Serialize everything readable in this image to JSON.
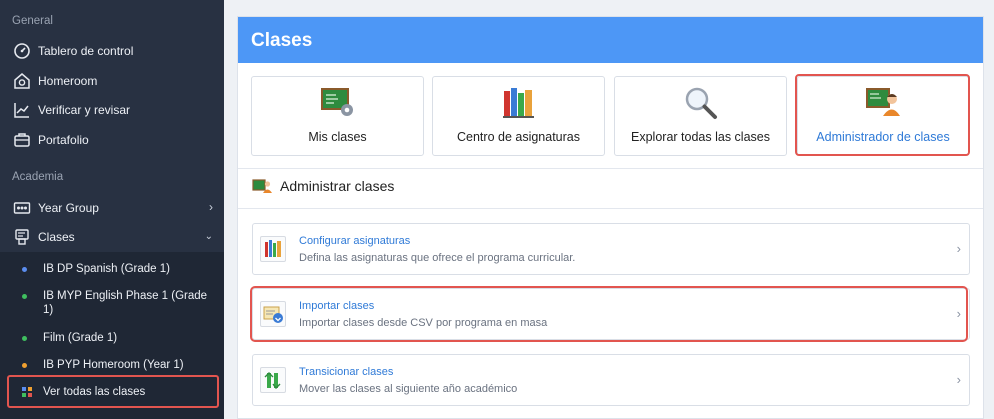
{
  "sidebar": {
    "section_general": "General",
    "section_academia": "Academia",
    "items": [
      {
        "label": "Tablero de control",
        "icon": "dashboard-icon"
      },
      {
        "label": "Homeroom",
        "icon": "homeroom-icon"
      },
      {
        "label": "Verificar y revisar",
        "icon": "chart-line-icon"
      },
      {
        "label": "Portafolio",
        "icon": "portfolio-icon"
      },
      {
        "label": "Year Group",
        "icon": "year-group-icon"
      },
      {
        "label": "Clases",
        "icon": "classes-icon"
      }
    ],
    "class_list": [
      {
        "label": "IB DP Spanish (Grade 1)",
        "color": "#5b8def"
      },
      {
        "label": "IB MYP English Phase 1 (Grade 1)",
        "color": "#3fbf5f"
      },
      {
        "label": "Film (Grade 1)",
        "color": "#3fbf5f"
      },
      {
        "label": "IB PYP Homeroom (Year 1)",
        "color": "#f0a030"
      }
    ],
    "view_all": "Ver todas las clases"
  },
  "main": {
    "title": "Clases",
    "tiles": [
      {
        "label": "Mis clases",
        "icon": "chalkboard-gear-icon"
      },
      {
        "label": "Centro de asignaturas",
        "icon": "books-icon"
      },
      {
        "label": "Explorar todas las clases",
        "icon": "magnifier-icon"
      },
      {
        "label": "Administrador de clases",
        "icon": "chalkboard-person-icon"
      }
    ],
    "admin_heading": "Administrar clases",
    "rows": [
      {
        "title": "Configurar asignaturas",
        "desc": "Defina las asignaturas que ofrece el programa curricular.",
        "icon": "books-icon"
      },
      {
        "title": "Importar clases",
        "desc": "Importar clases desde CSV por programa en masa",
        "icon": "import-icon"
      },
      {
        "title": "Transicionar clases",
        "desc": "Mover las clases al siguiente año académico",
        "icon": "transition-icon"
      }
    ]
  },
  "colors": {
    "accent": "#4d97f6",
    "link": "#2f7ad7",
    "highlight": "#e2554f",
    "sidebar_bg": "#283142"
  }
}
